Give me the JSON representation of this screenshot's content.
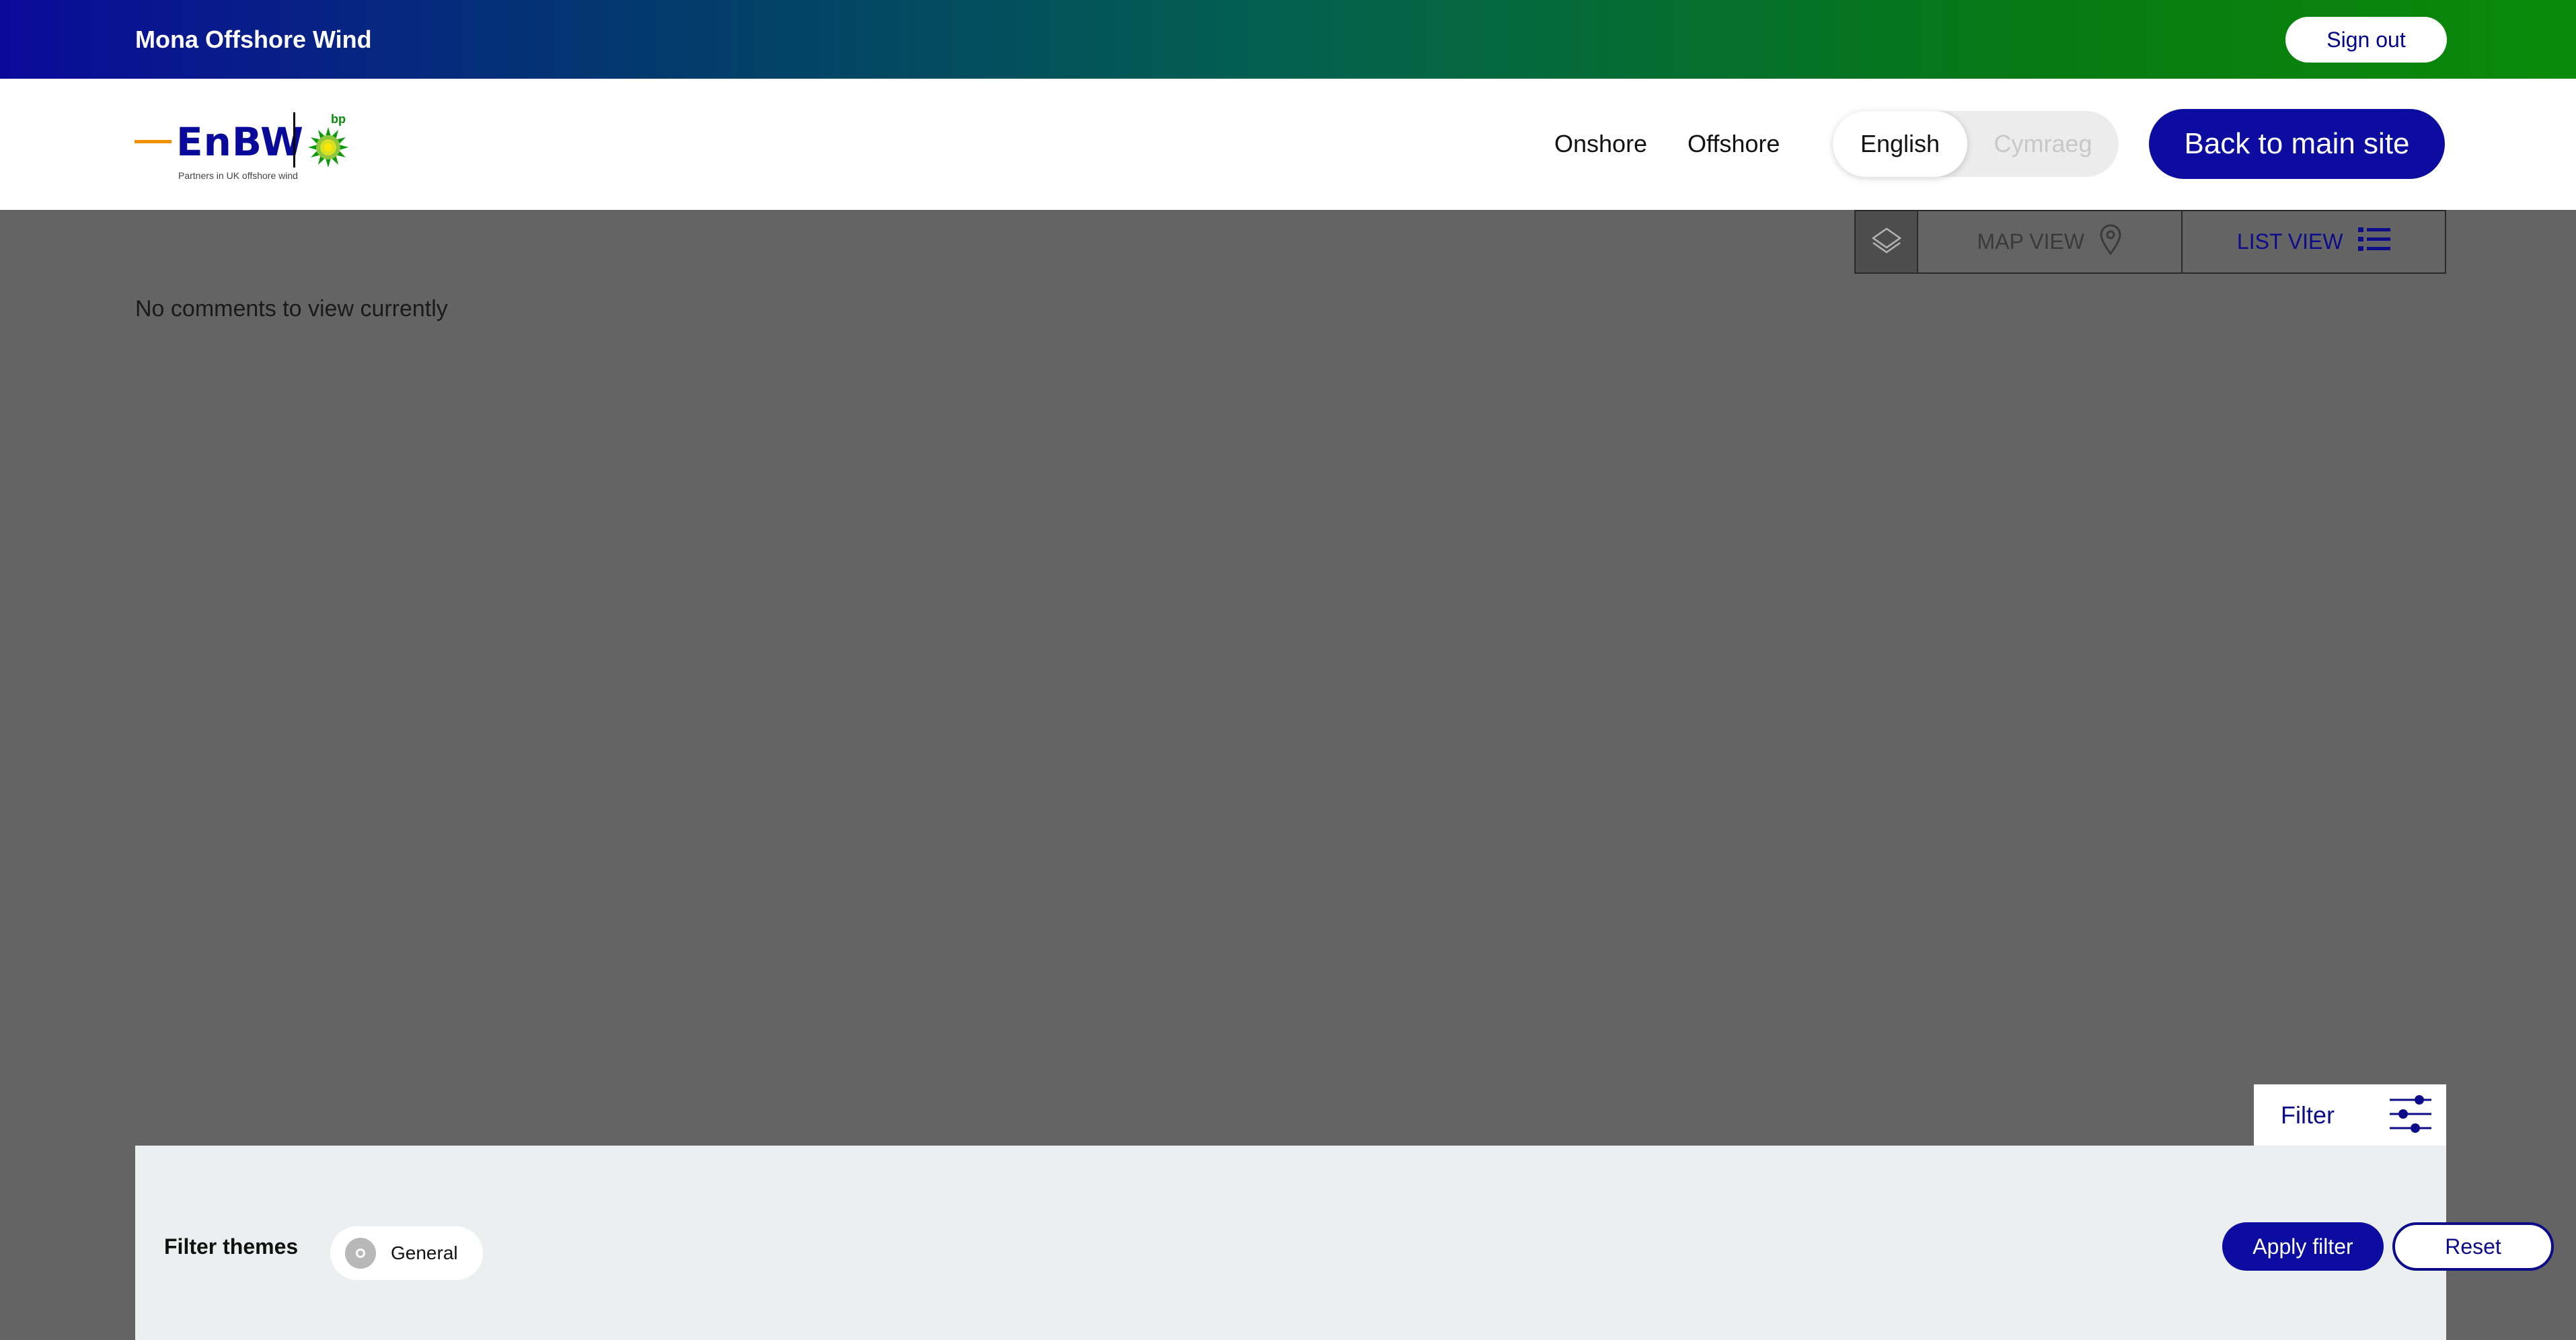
{
  "app": {
    "title": "Mona Offshore Wind",
    "sign_out_label": "Sign out"
  },
  "header": {
    "logo": {
      "brand": "EnBW",
      "partner": "bp",
      "tagline": "Partners in UK offshore wind"
    },
    "nav": [
      {
        "label": "Onshore"
      },
      {
        "label": "Offshore"
      }
    ],
    "language": {
      "active": "English",
      "inactive": "Cymraeg"
    },
    "back_label": "Back to main site"
  },
  "views": {
    "layers_icon": "layers-icon",
    "map_label": "MAP VIEW",
    "map_icon": "map-pin-icon",
    "list_label": "LIST VIEW",
    "list_icon": "list-icon",
    "selected": "LIST VIEW"
  },
  "content": {
    "empty_message": "No comments to view currently"
  },
  "filter": {
    "tab_label": "Filter",
    "tab_icon": "sliders-icon",
    "themes_label": "Filter themes",
    "themes": [
      {
        "label": "General",
        "icon": "general-theme-icon"
      }
    ],
    "apply_label": "Apply filter",
    "reset_label": "Reset"
  },
  "colors": {
    "primary": "#0c0ca0",
    "accent_orange": "#f29200",
    "overlay": "#646464"
  }
}
